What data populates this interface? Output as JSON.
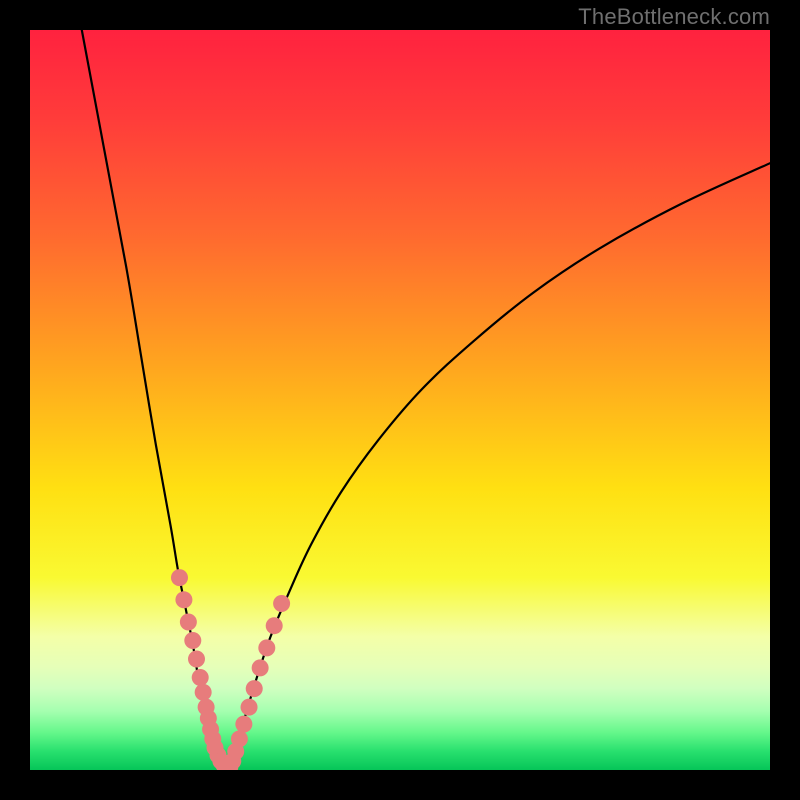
{
  "watermark": "TheBottleneck.com",
  "chart_data": {
    "type": "line",
    "title": "",
    "xlabel": "",
    "ylabel": "",
    "xlim": [
      0,
      100
    ],
    "ylim": [
      0,
      100
    ],
    "grid": false,
    "series": [
      {
        "name": "curve-left",
        "x": [
          7,
          10,
          13,
          15,
          17,
          19,
          20,
          21,
          22,
          22.8,
          23.5,
          24.0,
          24.5,
          25.0,
          25.8
        ],
        "y": [
          100,
          84,
          68,
          56,
          44,
          33,
          27,
          22,
          17,
          12,
          8,
          5.5,
          3.5,
          2.0,
          0.5
        ]
      },
      {
        "name": "curve-right",
        "x": [
          27.0,
          27.8,
          29.0,
          30.5,
          32.5,
          35.0,
          38.0,
          42.0,
          47.0,
          53.0,
          60.0,
          68.0,
          77.0,
          88.0,
          100.0
        ],
        "y": [
          0.5,
          3.0,
          7.0,
          12.0,
          18.0,
          24.0,
          30.5,
          37.5,
          44.5,
          51.5,
          58.0,
          64.5,
          70.5,
          76.5,
          82.0
        ]
      },
      {
        "name": "markers-left",
        "x": [
          20.2,
          20.8,
          21.4,
          22.0,
          22.5,
          23.0,
          23.4,
          23.8,
          24.1,
          24.4,
          24.7,
          25.0,
          25.4,
          25.8,
          26.2,
          26.6
        ],
        "y": [
          26.0,
          23.0,
          20.0,
          17.5,
          15.0,
          12.5,
          10.5,
          8.5,
          7.0,
          5.5,
          4.2,
          3.0,
          2.0,
          1.2,
          0.7,
          0.4
        ]
      },
      {
        "name": "markers-right",
        "x": [
          27.0,
          27.4,
          27.8,
          28.3,
          28.9,
          29.6,
          30.3,
          31.1,
          32.0,
          33.0,
          34.0
        ],
        "y": [
          0.4,
          1.2,
          2.5,
          4.2,
          6.2,
          8.5,
          11.0,
          13.8,
          16.5,
          19.5,
          22.5
        ]
      }
    ],
    "gradient_stops": [
      {
        "offset": 0.0,
        "color": "#ff223f"
      },
      {
        "offset": 0.12,
        "color": "#ff3c3a"
      },
      {
        "offset": 0.28,
        "color": "#ff6a2f"
      },
      {
        "offset": 0.45,
        "color": "#ffa41f"
      },
      {
        "offset": 0.62,
        "color": "#ffe012"
      },
      {
        "offset": 0.74,
        "color": "#f9f932"
      },
      {
        "offset": 0.82,
        "color": "#f4ffa8"
      },
      {
        "offset": 0.86,
        "color": "#e6ffb8"
      },
      {
        "offset": 0.89,
        "color": "#d0ffc0"
      },
      {
        "offset": 0.92,
        "color": "#a6ffb0"
      },
      {
        "offset": 0.95,
        "color": "#63f78a"
      },
      {
        "offset": 0.975,
        "color": "#28e06e"
      },
      {
        "offset": 1.0,
        "color": "#06c558"
      }
    ],
    "marker_color": "#e77c7c",
    "curve_color": "#000000"
  }
}
